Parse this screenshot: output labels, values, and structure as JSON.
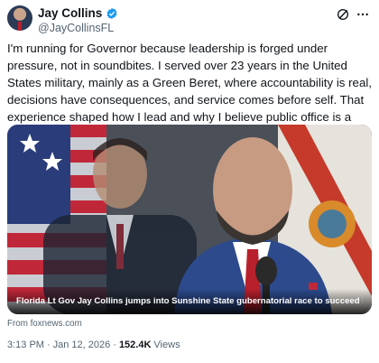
{
  "author": {
    "name": "Jay Collins",
    "handle": "@JayCollinsFL"
  },
  "post": {
    "text": "I'm running for Governor because leadership is forged under pressure, not in soundbites. I served over 23 years in the United States military, mainly as a Green Beret, where accountability is real, decisions have consequences, and service comes before self. That experience shaped how I lead and why I believe public office is a public trust."
  },
  "link_card": {
    "caption": "Florida Lt Gov Jay Collins jumps into Sunshine State gubernatorial race to succeed Ron...",
    "source": "From foxnews.com"
  },
  "meta": {
    "time": "3:13 PM",
    "separator": "·",
    "date": "Jan 12, 2026",
    "views_count": "152.4K",
    "views_label": "Views"
  },
  "colors": {
    "verified": "#1d9bf0",
    "text_primary": "#0f1419",
    "text_secondary": "#536471"
  },
  "icons": [
    "verified-badge-icon",
    "grok-icon",
    "more-options-icon"
  ]
}
